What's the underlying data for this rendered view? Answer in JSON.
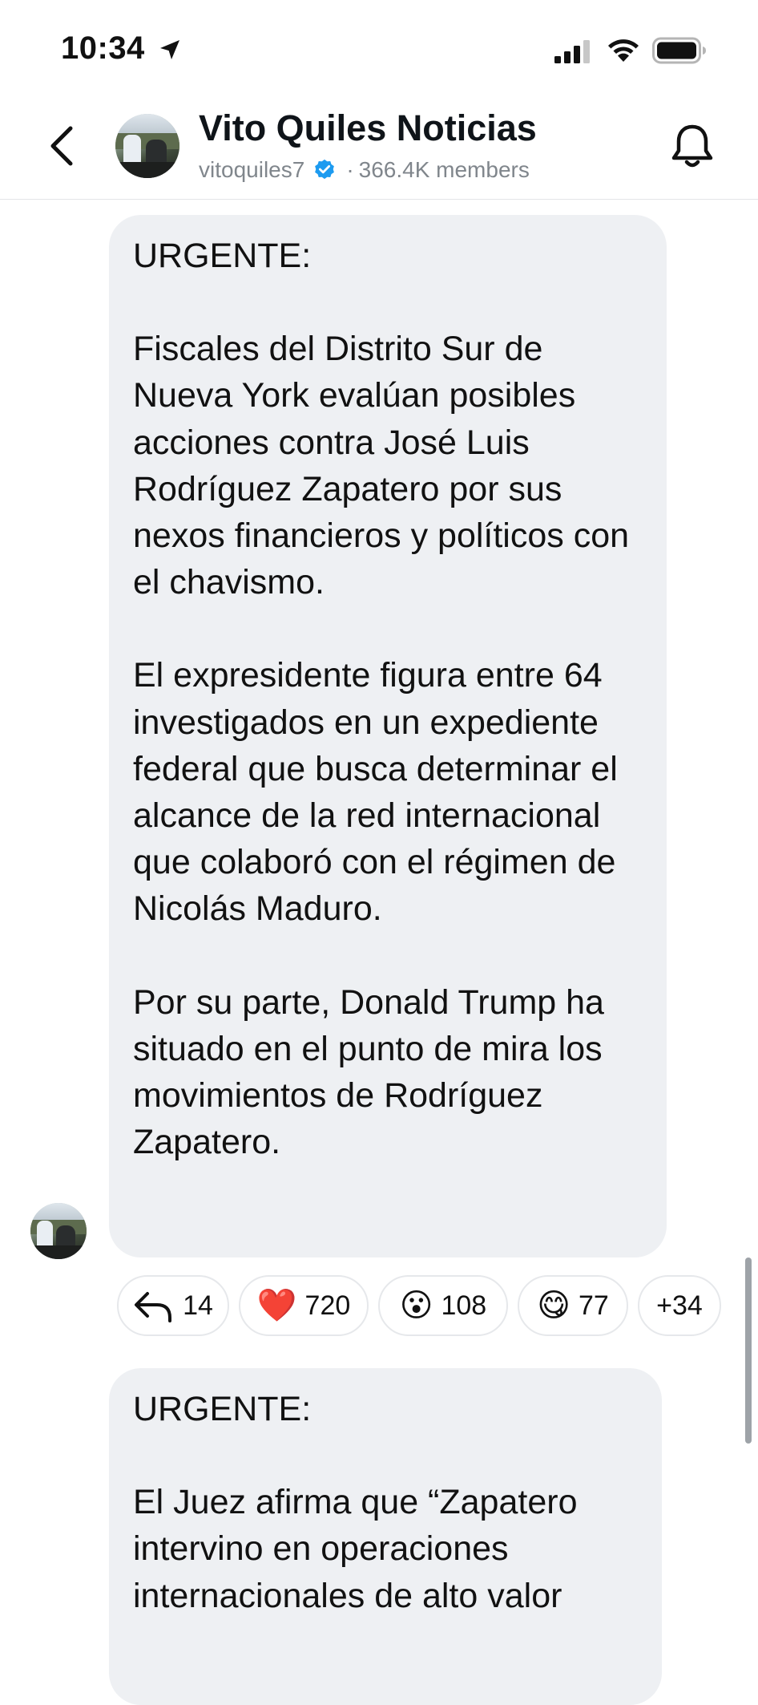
{
  "status_bar": {
    "time": "10:34"
  },
  "header": {
    "title": "Vito Quiles Noticias",
    "username": "vitoquiles7",
    "separator": "·",
    "members": "366.4K members"
  },
  "messages": [
    {
      "paragraphs": [
        "URGENTE:",
        "Fiscales del Distrito Sur de Nueva York evalúan posibles acciones contra José Luis Rodríguez Zapatero por sus nexos financieros y políticos con el chavismo.",
        "El expresidente figura entre 64 investigados en un expediente federal que busca determinar el alcance de la red internacional que colaboró con el régimen de Nicolás Maduro.",
        "Por su parte, Donald Trump ha situado en el punto de mira los movimientos de Rodríguez Zapatero."
      ],
      "reactions": {
        "replies": "14",
        "heart": {
          "emoji": "❤️",
          "count": "720"
        },
        "wow": {
          "emoji": "😮",
          "count": "108"
        },
        "yum": {
          "emoji": "😋",
          "count": "77"
        },
        "more": "+34"
      }
    },
    {
      "paragraphs": [
        "URGENTE:",
        "El Juez afirma que “Zapatero intervino en operaciones internacionales de alto valor"
      ]
    }
  ],
  "colors": {
    "bubble_bg": "#eef0f3",
    "verified": "#1d9bf0",
    "secondary_text": "#80868c"
  },
  "icons": [
    "location-arrow-icon",
    "signal-icon",
    "wifi-icon",
    "battery-icon",
    "back-chevron-icon",
    "verified-badge-icon",
    "bell-icon",
    "reply-arrow-icon"
  ]
}
